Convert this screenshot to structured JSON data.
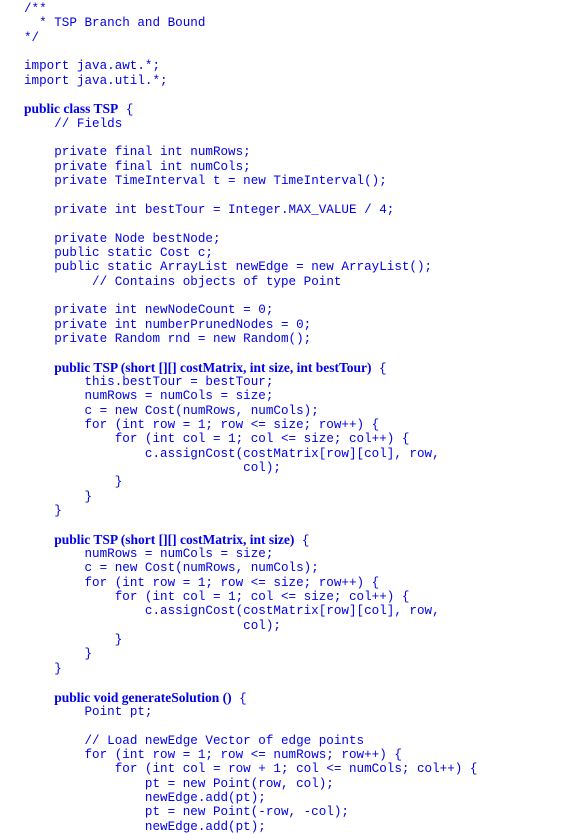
{
  "document": {
    "title": "TSP Branch and Bound",
    "lines": [
      {
        "indent": 0,
        "text": "/**"
      },
      {
        "indent": 0,
        "text": "  * TSP Branch and Bound"
      },
      {
        "indent": 0,
        "text": "*/"
      },
      {
        "indent": 0,
        "text": ""
      },
      {
        "indent": 0,
        "text": "import java.awt.*;"
      },
      {
        "indent": 0,
        "text": "import java.util.*;"
      },
      {
        "indent": 0,
        "text": ""
      },
      {
        "indent": 0,
        "bold": "public class TSP",
        "text": " {"
      },
      {
        "indent": 4,
        "text": "// Fields"
      },
      {
        "indent": 0,
        "text": ""
      },
      {
        "indent": 4,
        "text": "private final int numRows;"
      },
      {
        "indent": 4,
        "text": "private final int numCols;"
      },
      {
        "indent": 4,
        "text": "private TimeInterval t = new TimeInterval();"
      },
      {
        "indent": 0,
        "text": ""
      },
      {
        "indent": 4,
        "text": "private int bestTour = Integer.MAX_VALUE / 4;"
      },
      {
        "indent": 0,
        "text": ""
      },
      {
        "indent": 4,
        "text": "private Node bestNode;"
      },
      {
        "indent": 4,
        "text": "public static Cost c;"
      },
      {
        "indent": 4,
        "text": "public static ArrayList newEdge = new ArrayList();"
      },
      {
        "indent": 9,
        "text": "// Contains objects of type Point"
      },
      {
        "indent": 0,
        "text": ""
      },
      {
        "indent": 4,
        "text": "private int newNodeCount = 0;"
      },
      {
        "indent": 4,
        "text": "private int numberPrunedNodes = 0;"
      },
      {
        "indent": 4,
        "text": "private Random rnd = new Random();"
      },
      {
        "indent": 0,
        "text": ""
      },
      {
        "indent": 4,
        "bold": "public TSP (short [][] costMatrix, int size, int bestTour)",
        "text": " {"
      },
      {
        "indent": 8,
        "text": "this.bestTour = bestTour;"
      },
      {
        "indent": 8,
        "text": "numRows = numCols = size;"
      },
      {
        "indent": 8,
        "text": "c = new Cost(numRows, numCols);"
      },
      {
        "indent": 8,
        "text": "for (int row = 1; row <= size; row++) {"
      },
      {
        "indent": 12,
        "text": "for (int col = 1; col <= size; col++) {"
      },
      {
        "indent": 16,
        "text": "c.assignCost(costMatrix[row][col], row,"
      },
      {
        "indent": 29,
        "text": "col);"
      },
      {
        "indent": 12,
        "text": "}"
      },
      {
        "indent": 8,
        "text": "}"
      },
      {
        "indent": 4,
        "text": "}"
      },
      {
        "indent": 0,
        "text": ""
      },
      {
        "indent": 4,
        "bold": "public TSP (short [][] costMatrix, int size)",
        "text": " {"
      },
      {
        "indent": 8,
        "text": "numRows = numCols = size;"
      },
      {
        "indent": 8,
        "text": "c = new Cost(numRows, numCols);"
      },
      {
        "indent": 8,
        "text": "for (int row = 1; row <= size; row++) {"
      },
      {
        "indent": 12,
        "text": "for (int col = 1; col <= size; col++) {"
      },
      {
        "indent": 16,
        "text": "c.assignCost(costMatrix[row][col], row,"
      },
      {
        "indent": 29,
        "text": "col);"
      },
      {
        "indent": 12,
        "text": "}"
      },
      {
        "indent": 8,
        "text": "}"
      },
      {
        "indent": 4,
        "text": "}"
      },
      {
        "indent": 0,
        "text": ""
      },
      {
        "indent": 4,
        "bold": "public void generateSolution ()",
        "text": " {"
      },
      {
        "indent": 8,
        "text": "Point pt;"
      },
      {
        "indent": 0,
        "text": ""
      },
      {
        "indent": 8,
        "text": "// Load newEdge Vector of edge points"
      },
      {
        "indent": 8,
        "text": "for (int row = 1; row <= numRows; row++) {"
      },
      {
        "indent": 12,
        "text": "for (int col = row + 1; col <= numCols; col++) {"
      },
      {
        "indent": 16,
        "text": "pt = new Point(row, col);"
      },
      {
        "indent": 16,
        "text": "newEdge.add(pt);"
      },
      {
        "indent": 16,
        "text": "pt = new Point(-row, -col);"
      },
      {
        "indent": 16,
        "text": "newEdge.add(pt);"
      }
    ]
  },
  "colors": {
    "text": "#0000e6",
    "background": "#ffffff"
  }
}
